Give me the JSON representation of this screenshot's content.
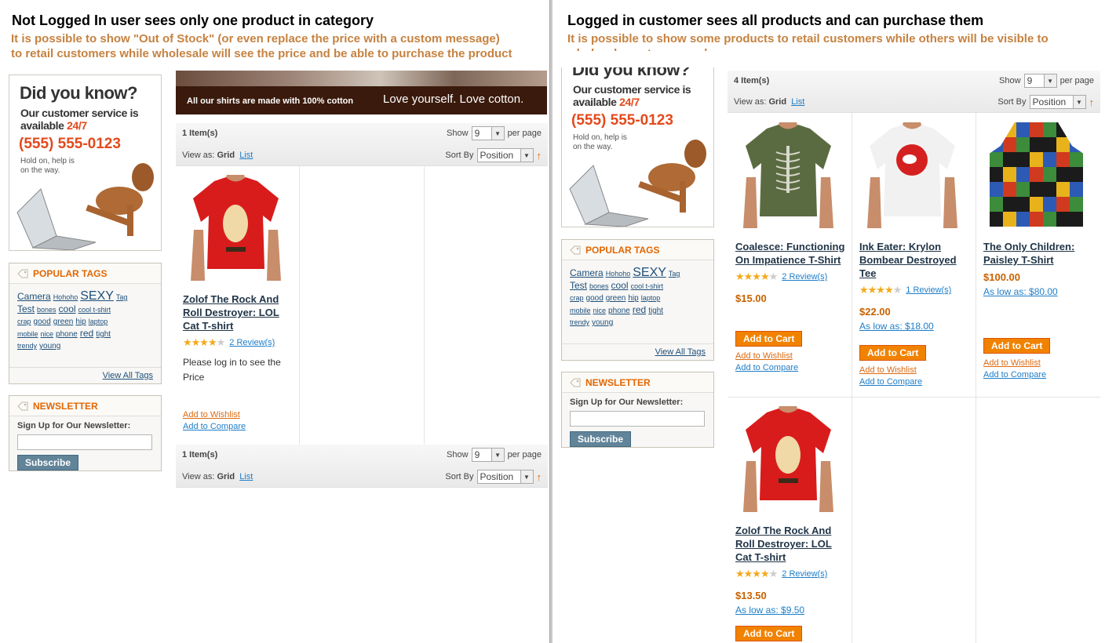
{
  "left": {
    "title": "Not Logged In user sees only one product in category",
    "note_line1": "It is possible to show \"Out of Stock\" (or even replace the price with a custom message)",
    "note_line2": "to retail customers while wholesale will see the price and be able to purchase the product",
    "banner": {
      "caption": "All our shirts are made with 100% cotton",
      "slogan": "Love yourself. Love cotton."
    },
    "toolbar_top": {
      "amount": "1 Item(s)",
      "show": "Show",
      "limit": "9",
      "per_page": "per page",
      "view_as": "View as:",
      "grid": "Grid",
      "list": "List",
      "sort_by": "Sort By",
      "sort_value": "Position"
    },
    "toolbar_bottom": {
      "amount": "1 Item(s)",
      "show": "Show",
      "limit": "9",
      "per_page": "per page",
      "view_as": "View as:",
      "grid": "Grid",
      "list": "List",
      "sort_by": "Sort By",
      "sort_value": "Position"
    },
    "product": {
      "name": "Zolof The Rock And Roll Destroyer: LOL Cat T-shirt",
      "rating": 3.5,
      "reviews": "2 Review(s)",
      "login_msg": "Please log in to see the Price",
      "wishlist": "Add to Wishlist",
      "compare": "Add to Compare"
    }
  },
  "right": {
    "title": "Logged in customer sees all products and can purchase them",
    "note_line1": "It is possible to show some products to retail customers while others will be visible to",
    "note_line2": "wholesale customers only",
    "toolbar": {
      "amount": "4 Item(s)",
      "show": "Show",
      "limit": "9",
      "per_page": "per page",
      "view_as": "View as:",
      "grid": "Grid",
      "list": "List",
      "sort_by": "Sort By",
      "sort_value": "Position"
    },
    "products": [
      {
        "name": "Coalesce: Functioning On Impatience T-Shirt",
        "rating": 4,
        "reviews": "2 Review(s)",
        "price": "$15.00",
        "as_low": "",
        "cart": "Add to Cart",
        "wishlist": "Add to Wishlist",
        "compare": "Add to Compare"
      },
      {
        "name": "Ink Eater: Krylon Bombear Destroyed Tee",
        "rating": 4,
        "reviews": "1 Review(s)",
        "price": "$22.00",
        "as_low": "As low as: $18.00",
        "cart": "Add to Cart",
        "wishlist": "Add to Wishlist",
        "compare": "Add to Compare"
      },
      {
        "name": "The Only Children: Paisley T-Shirt",
        "rating": 0,
        "reviews": "",
        "price": "$100.00",
        "as_low": "As low as: $80.00",
        "cart": "Add to Cart",
        "wishlist": "Add to Wishlist",
        "compare": "Add to Compare"
      },
      {
        "name": "Zolof The Rock And Roll Destroyer: LOL Cat T-shirt",
        "rating": 3.5,
        "reviews": "2 Review(s)",
        "price": "$13.50",
        "as_low": "As low as: $9.50",
        "cart": "Add to Cart"
      }
    ]
  },
  "callout": {
    "did_you_know": "Did you know?",
    "cs_line1": "Our customer service is",
    "cs_line2": "available",
    "cs_hours": "24/7",
    "phone": "(555) 555-0123",
    "hold_line1": "Hold on, help is",
    "hold_line2": "on the way."
  },
  "popular_tags": {
    "title": "POPULAR TAGS",
    "tags": [
      "Camera",
      "Hohoho",
      "SEXY",
      "Tag",
      "Test",
      "bones",
      "cool",
      "cool t-shirt",
      "crap",
      "good",
      "green",
      "hip",
      "laptop",
      "mobile",
      "nice",
      "phone",
      "red",
      "tight",
      "trendy",
      "young"
    ],
    "view_all": "View All Tags"
  },
  "newsletter": {
    "title": "NEWSLETTER",
    "label": "Sign Up for Our Newsletter:",
    "button": "Subscribe"
  },
  "colors": {
    "accent_orange": "#e26703",
    "link_blue": "#1e7ec8",
    "button_orange": "#f18200",
    "heading_note": "#c68240",
    "phone_red": "#e24a1c"
  }
}
